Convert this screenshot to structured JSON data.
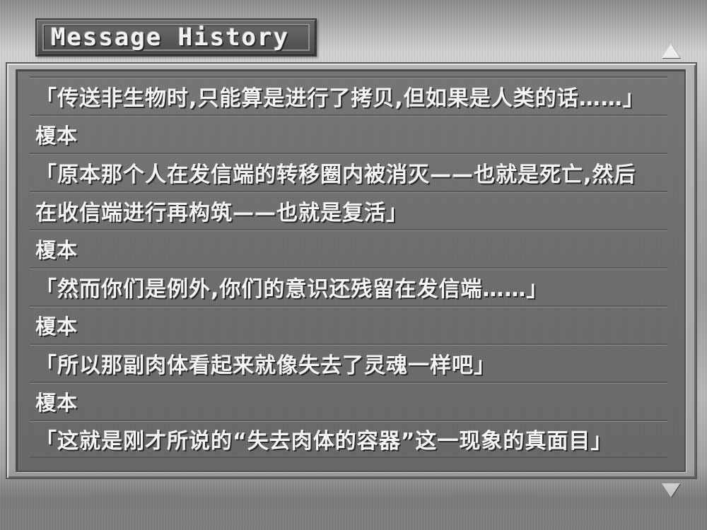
{
  "header": {
    "title": "Message History"
  },
  "scroll": {
    "up_icon": "triangle-up-icon",
    "down_icon": "triangle-down-icon"
  },
  "history": {
    "lines": [
      "「传送非生物时,只能算是进行了拷贝,但如果是人类的话……」",
      "榎本",
      "「原本那个人在发信端的转移圈内被消灭——也就是死亡,然后",
      "在收信端进行再构筑——也就是复活」",
      "榎本",
      "「然而你们是例外,你们的意识还残留在发信端……」",
      "榎本",
      "「所以那副肉体看起来就像失去了灵魂一样吧」",
      "榎本",
      "「这就是刚才所说的“失去肉体的容器”这一现象的真面目」"
    ]
  }
}
